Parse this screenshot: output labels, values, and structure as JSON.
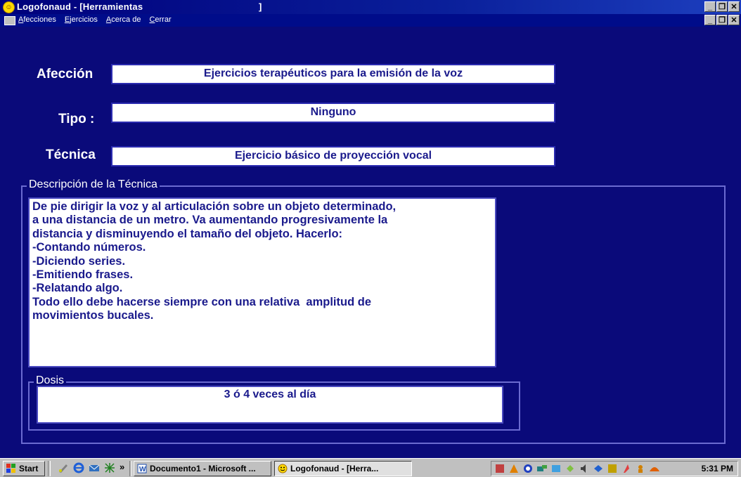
{
  "window": {
    "title": "Logofonaud - [Herramientas",
    "title_bracket": "]",
    "controls": [
      "_",
      "❐",
      "✕"
    ]
  },
  "menu": {
    "items": [
      "Afecciones",
      "Ejercicios",
      "Acerca de",
      "Cerrar"
    ]
  },
  "form": {
    "afeccion_label": "Afección",
    "afeccion_value": "Ejercicios terapéuticos para la emisión de la voz",
    "tipo_label": "Tipo :",
    "tipo_value": "Ninguno",
    "tecnica_label": "Técnica",
    "tecnica_value": "Ejercicio básico de proyección vocal"
  },
  "descripcion": {
    "legend": "Descripción de la Técnica",
    "lines": [
      "De pie dirigir la voz y al articulación sobre un objeto determinado,",
      "a una distancia de un metro. Va aumentando progresivamente la",
      "distancia y disminuyendo el tamaño del objeto. Hacerlo:",
      "-Contando números.",
      "-Diciendo series.",
      "-Emitiendo frases.",
      "-Relatando algo.",
      "Todo ello debe hacerse siempre con una relativa  amplitud de",
      "movimientos bucales."
    ]
  },
  "dosis": {
    "legend": "Dosis",
    "value": "3 ó 4 veces al día"
  },
  "taskbar": {
    "start_label": "Start",
    "chevron": "»",
    "tasks": [
      "Documento1 - Microsoft ...",
      "Logofonaud - [Herra..."
    ],
    "clock": "5:31 PM"
  },
  "colors": {
    "background": "#0a0a7a",
    "field_text": "#1a1a8c",
    "title_bar": "#00007b"
  }
}
